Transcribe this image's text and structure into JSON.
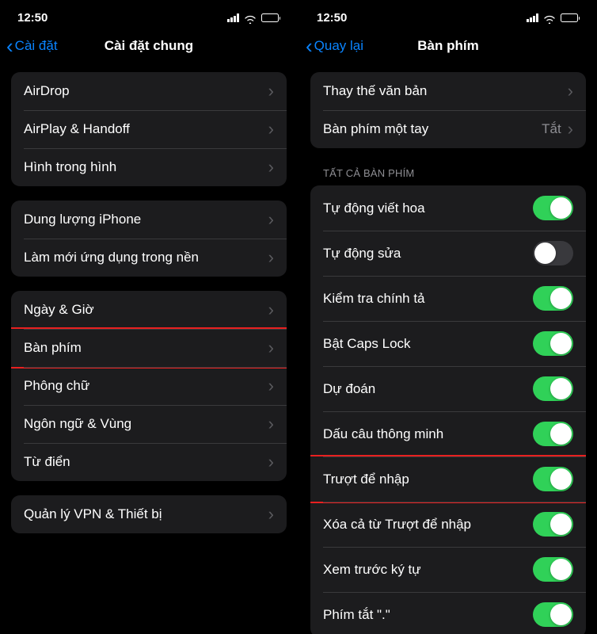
{
  "statusBar": {
    "time": "12:50"
  },
  "left": {
    "backLabel": "Cài đặt",
    "title": "Cài đặt chung",
    "groups": [
      [
        {
          "label": "AirDrop"
        },
        {
          "label": "AirPlay & Handoff"
        },
        {
          "label": "Hình trong hình"
        }
      ],
      [
        {
          "label": "Dung lượng iPhone"
        },
        {
          "label": "Làm mới ứng dụng trong nền"
        }
      ],
      [
        {
          "label": "Ngày & Giờ"
        },
        {
          "label": "Bàn phím",
          "highlight": true
        },
        {
          "label": "Phông chữ"
        },
        {
          "label": "Ngôn ngữ & Vùng"
        },
        {
          "label": "Từ điển"
        }
      ],
      [
        {
          "label": "Quản lý VPN & Thiết bị"
        }
      ]
    ]
  },
  "right": {
    "backLabel": "Quay lại",
    "title": "Bàn phím",
    "topGroup": [
      {
        "label": "Thay thế văn bản",
        "type": "nav"
      },
      {
        "label": "Bàn phím một tay",
        "type": "navValue",
        "value": "Tắt"
      }
    ],
    "sectionHeader": "TẤT CẢ BÀN PHÍM",
    "toggles": [
      {
        "label": "Tự động viết hoa",
        "on": true
      },
      {
        "label": "Tự động sửa",
        "on": false
      },
      {
        "label": "Kiểm tra chính tả",
        "on": true
      },
      {
        "label": "Bật Caps Lock",
        "on": true
      },
      {
        "label": "Dự đoán",
        "on": true
      },
      {
        "label": "Dấu câu thông minh",
        "on": true
      },
      {
        "label": "Trượt để nhập",
        "on": true,
        "highlight": true
      },
      {
        "label": "Xóa cả từ Trượt để nhập",
        "on": true
      },
      {
        "label": "Xem trước ký tự",
        "on": true
      },
      {
        "label": "Phím tắt \".\"",
        "on": true
      }
    ]
  }
}
